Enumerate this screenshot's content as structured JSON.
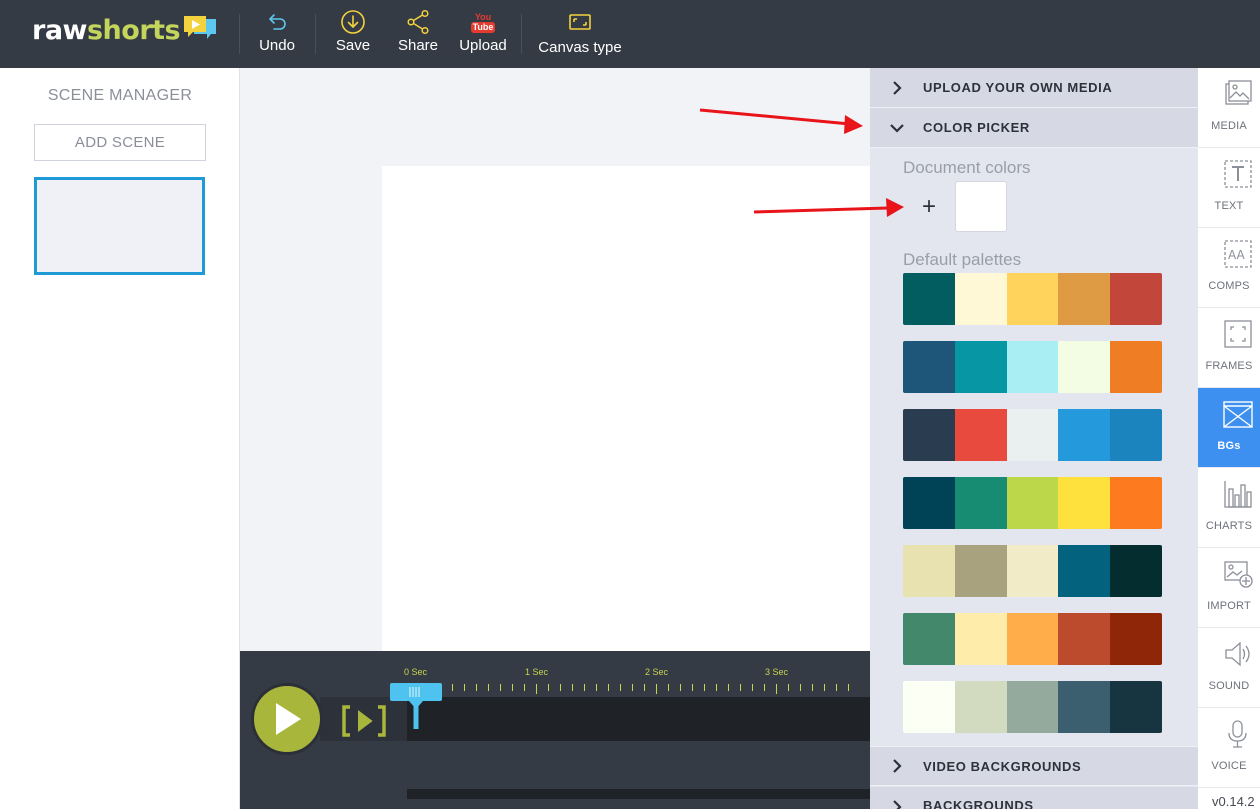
{
  "app": {
    "logo_raw": "raw",
    "logo_shorts": "shorts"
  },
  "toolbar": {
    "undo_label": "Undo",
    "save_label": "Save",
    "share_label": "Share",
    "upload_label": "Upload",
    "upload_badge_top": "You",
    "upload_badge_bottom": "Tube",
    "canvas_type_label": "Canvas type"
  },
  "scene_manager": {
    "title": "SCENE MANAGER",
    "add_scene_label": "ADD SCENE"
  },
  "timeline": {
    "ruler_labels": [
      "0 Sec",
      "1 Sec",
      "2 Sec",
      "3 Sec"
    ]
  },
  "media_panel": {
    "upload_own_media": "UPLOAD YOUR OWN MEDIA",
    "color_picker": "COLOR PICKER",
    "document_colors_label": "Document colors",
    "add_color_symbol": "+",
    "document_colors": [
      "#ffffff"
    ],
    "default_palettes_label": "Default palettes",
    "palettes": [
      [
        "#025d61",
        "#fff8d6",
        "#ffd35c",
        "#df9a44",
        "#c2473a"
      ],
      [
        "#1e5679",
        "#0796a4",
        "#a8eef2",
        "#f2fde4",
        "#ef7d23"
      ],
      [
        "#2a3c4f",
        "#e84b3e",
        "#eaeff0",
        "#2499dc",
        "#1b84be"
      ],
      [
        "#004356",
        "#178c72",
        "#bcd84a",
        "#fee13c",
        "#fe7a1e"
      ],
      [
        "#e8e1b0",
        "#a8a27f",
        "#f1ebc8",
        "#03637e",
        "#032d2e"
      ],
      [
        "#43886b",
        "#feecaa",
        "#ffac4b",
        "#bc4a2d",
        "#8f2608"
      ],
      [
        "#fcfff4",
        "#d2dbc0",
        "#93aa9c",
        "#3c5f70",
        "#173441"
      ]
    ],
    "video_backgrounds": "VIDEO BACKGROUNDS",
    "backgrounds": "BACKGROUNDS"
  },
  "side_nav": {
    "items": [
      {
        "label": "MEDIA",
        "icon": "image-icon"
      },
      {
        "label": "TEXT",
        "icon": "text-icon"
      },
      {
        "label": "COMPS",
        "icon": "comps-icon"
      },
      {
        "label": "FRAMES",
        "icon": "frames-icon"
      },
      {
        "label": "BGs",
        "icon": "backgrounds-icon"
      },
      {
        "label": "CHARTS",
        "icon": "chart-icon"
      },
      {
        "label": "IMPORT",
        "icon": "import-icon"
      },
      {
        "label": "SOUND",
        "icon": "speaker-icon"
      },
      {
        "label": "VOICE",
        "icon": "microphone-icon"
      }
    ],
    "active_index": 4,
    "version": "v0.14.2"
  },
  "colors": {
    "topbar": "#353b45",
    "accent_yellow": "#c3d55b",
    "active_blue": "#3d8ff0",
    "scene_border": "#1e9ad6",
    "play_green": "#a9b63c",
    "playhead_blue": "#4fc3f0",
    "annotation_red": "#e8141a"
  }
}
